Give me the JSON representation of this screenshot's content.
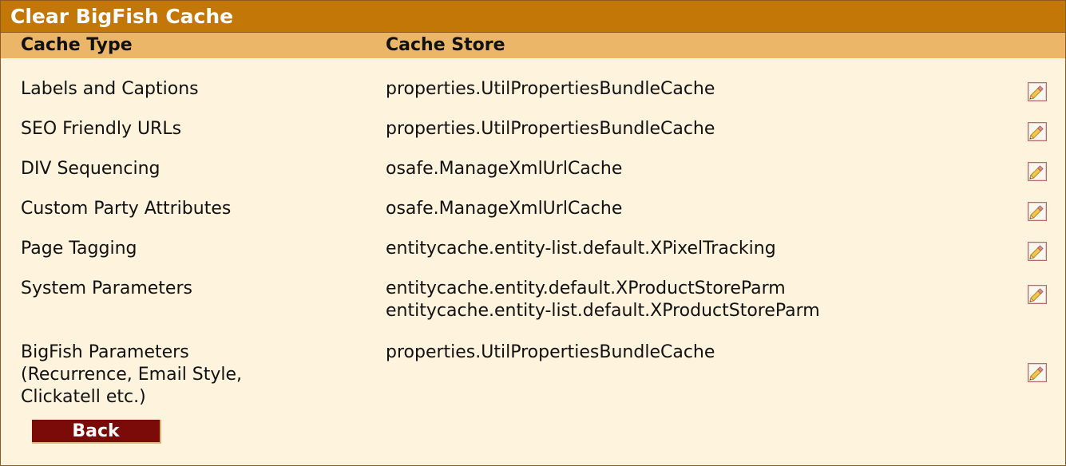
{
  "title": "Clear BigFish Cache",
  "columns": {
    "type": "Cache Type",
    "store": "Cache Store"
  },
  "rows": [
    {
      "type": [
        "Labels and Captions"
      ],
      "store": [
        "properties.UtilPropertiesBundleCache"
      ]
    },
    {
      "type": [
        "SEO Friendly URLs"
      ],
      "store": [
        "properties.UtilPropertiesBundleCache"
      ]
    },
    {
      "type": [
        "DIV Sequencing"
      ],
      "store": [
        "osafe.ManageXmlUrlCache"
      ]
    },
    {
      "type": [
        "Custom Party Attributes"
      ],
      "store": [
        "osafe.ManageXmlUrlCache"
      ]
    },
    {
      "type": [
        "Page Tagging"
      ],
      "store": [
        "entitycache.entity-list.default.XPixelTracking"
      ]
    },
    {
      "type": [
        "System Parameters"
      ],
      "store": [
        "entitycache.entity.default.XProductStoreParm",
        "entitycache.entity-list.default.XProductStoreParm"
      ]
    },
    {
      "type": [
        "BigFish Parameters",
        "(Recurrence, Email Style,",
        "Clickatell etc.)"
      ],
      "store": [
        "properties.UtilPropertiesBundleCache"
      ]
    }
  ],
  "edit_icon": "pencil-edit-icon",
  "back_label": "Back",
  "colors": {
    "title_bar": "#c27707",
    "header_row": "#ecb668",
    "panel_bg": "#fef3dd",
    "back_button": "#7a0b08"
  }
}
